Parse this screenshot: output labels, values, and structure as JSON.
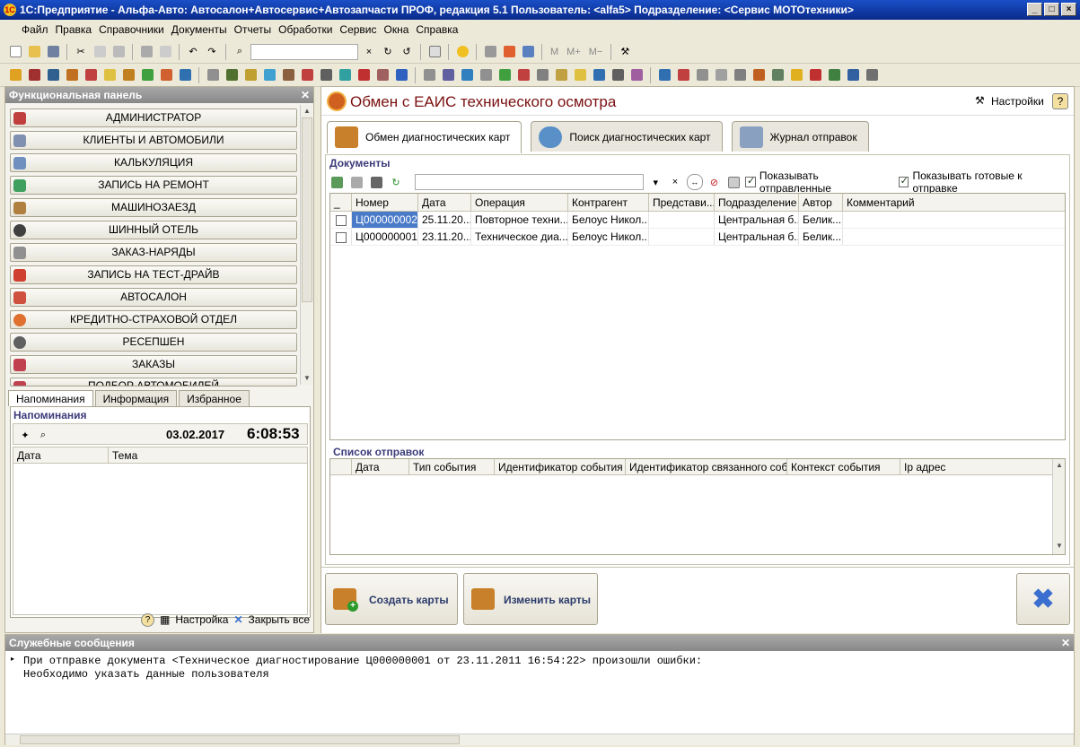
{
  "window": {
    "title": "1С:Предприятие - Альфа-Авто: Автосалон+Автосервис+Автозапчасти ПРОФ, редакция 5.1    Пользователь: <alfa5>    Подразделение: <Сервис МОТОтехники>"
  },
  "menu": [
    "Файл",
    "Правка",
    "Справочники",
    "Документы",
    "Отчеты",
    "Обработки",
    "Сервис",
    "Окна",
    "Справка"
  ],
  "toolbar2": {
    "m": "M",
    "mplus": "M+",
    "mminus": "M−"
  },
  "leftpanel": {
    "title": "Функциональная панель",
    "items": [
      "Администратор",
      "Клиенты и автомобили",
      "Калькуляция",
      "Запись на ремонт",
      "Машинозаезд",
      "Шинный отель",
      "Заказ-наряды",
      "Запись на тест-драйв",
      "Автосалон",
      "Кредитно-страховой отдел",
      "Ресепшен",
      "Заказы",
      "Подбор автомобилей"
    ],
    "tabs": [
      "Напоминания",
      "Информация",
      "Избранное"
    ],
    "reminders_title": "Напоминания",
    "date": "03.02.2017",
    "time": "6:08:53",
    "cols": [
      "Дата",
      "Тема"
    ],
    "footer_settings": "Настройка",
    "footer_close": "Закрыть все"
  },
  "main": {
    "title": "Обмен с ЕАИС технического осмотра",
    "settings": "Настройки",
    "tabs": [
      "Обмен диагностических карт",
      "Поиск диагностических карт",
      "Журнал отправок"
    ],
    "docs_title": "Документы",
    "show_sent": "Показывать отправленные",
    "show_ready": "Показывать готовые к отправке",
    "doc_cols": [
      "_",
      "Номер",
      "Дата",
      "Операция",
      "Контрагент",
      "Представи...",
      "Подразделение",
      "Автор",
      "Комментарий"
    ],
    "rows": [
      [
        "Ц000000002",
        "25.11.20...",
        "Повторное техни...",
        "Белоус Никол...",
        "",
        "Центральная б...",
        "Белик...",
        ""
      ],
      [
        "Ц000000001",
        "23.11.20...",
        "Техническое диа...",
        "Белоус Никол...",
        "",
        "Центральная б...",
        "Белик...",
        ""
      ]
    ],
    "send_title": "Список отправок",
    "send_cols": [
      "Дата",
      "Тип события",
      "Идентификатор события",
      "Идентификатор связанного соб...",
      "Контекст события",
      "Ip адрес"
    ],
    "btn_create": "Создать карты",
    "btn_change": "Изменить карты"
  },
  "service": {
    "title": "Служебные сообщения",
    "line1": "При отправке документа <Техническое диагностирование Ц000000001 от 23.11.2011 16:54:22> произошли ошибки:",
    "line2": "Необходимо указать данные пользователя"
  },
  "colors": {
    "title_bar": "#0a2a8a",
    "main_title": "#7a1010",
    "close_x": "#3a6fd0"
  }
}
